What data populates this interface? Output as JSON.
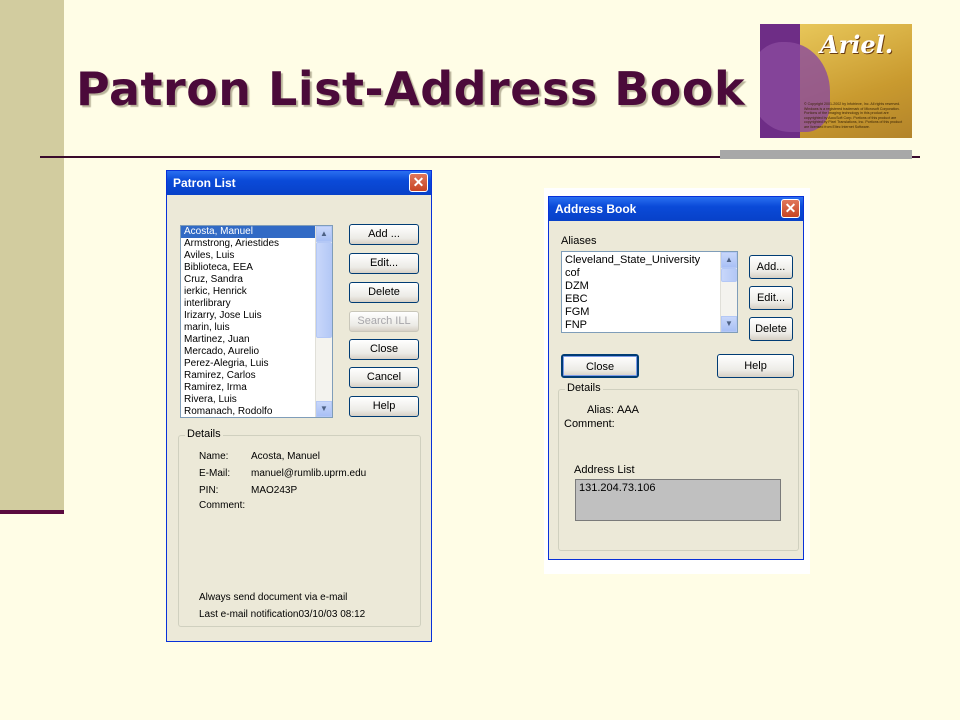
{
  "slide": {
    "title": "Patron List-Address Book"
  },
  "logo": {
    "name": "Ariel.",
    "fine_print": "© Copyright 2001-2002 by Infotrieve, Inc. All rights reserved. Windows is a registered trademark of Microsoft Corporation. Portions of the imaging technology in this product are copyrighted by AccuSoft Corp. Portions of this product are copyrighted by Pixel Translations, Inc. Portions of this product are licensed from Eltec Internet Software."
  },
  "patron_list": {
    "title": "Patron List",
    "patrons": [
      "Acosta, Manuel",
      "Armstrong, Ariestides",
      "Aviles, Luis",
      "Biblioteca, EEA",
      "Cruz, Sandra",
      "ierkic, Henrick",
      "interlibrary",
      "Irizarry, Jose Luis",
      "marin, luis",
      "Martinez, Juan",
      "Mercado, Aurelio",
      "Perez-Alegria, Luis",
      "Ramirez, Carlos",
      "Ramirez, Irma",
      "Rivera, Luis",
      "Romanach, Rodolfo"
    ],
    "selected": "Acosta, Manuel",
    "buttons": {
      "add": "Add ...",
      "edit": "Edit...",
      "delete": "Delete",
      "search_ill": "Search ILL",
      "close": "Close",
      "cancel": "Cancel",
      "help": "Help"
    },
    "details": {
      "label": "Details",
      "name_label": "Name:",
      "name_value": "Acosta, Manuel",
      "email_label": "E-Mail:",
      "email_value": "manuel@rumlib.uprm.edu",
      "pin_label": "PIN:",
      "pin_value": "MAO243P",
      "comment_label": "Comment:",
      "always_send": "Always send document via e-mail",
      "last_notification": "Last e-mail notification03/10/03  08:12"
    }
  },
  "address_book": {
    "title": "Address Book",
    "aliases_label": "Aliases",
    "aliases": [
      "Cleveland_State_University",
      "cof",
      "DZM",
      "EBC",
      "FGM",
      "FNP"
    ],
    "buttons": {
      "add": "Add...",
      "edit": "Edit...",
      "delete": "Delete",
      "close": "Close",
      "help": "Help"
    },
    "details": {
      "label": "Details",
      "alias_label": "Alias:",
      "alias_value": "AAA",
      "comment_label": "Comment:",
      "address_list_label": "Address List",
      "address": "131.204.73.106"
    }
  }
}
